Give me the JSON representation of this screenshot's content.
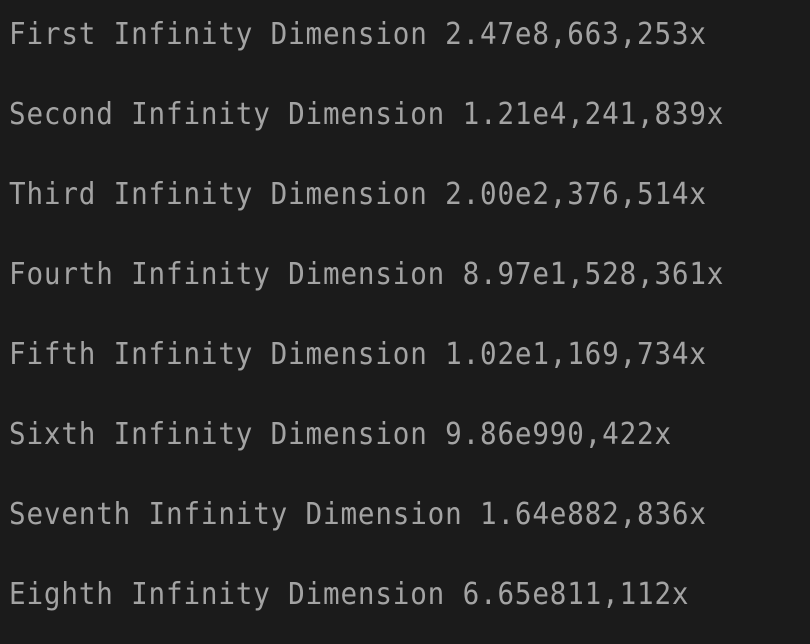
{
  "dimensions": [
    {
      "name": "First Infinity Dimension",
      "multiplier": "2.47e8,663,253x"
    },
    {
      "name": "Second Infinity Dimension",
      "multiplier": "1.21e4,241,839x"
    },
    {
      "name": "Third Infinity Dimension",
      "multiplier": "2.00e2,376,514x"
    },
    {
      "name": "Fourth Infinity Dimension",
      "multiplier": "8.97e1,528,361x"
    },
    {
      "name": "Fifth Infinity Dimension",
      "multiplier": "1.02e1,169,734x"
    },
    {
      "name": "Sixth Infinity Dimension",
      "multiplier": "9.86e990,422x"
    },
    {
      "name": "Seventh Infinity Dimension",
      "multiplier": "1.64e882,836x"
    },
    {
      "name": "Eighth Infinity Dimension",
      "multiplier": "6.65e811,112x"
    }
  ]
}
